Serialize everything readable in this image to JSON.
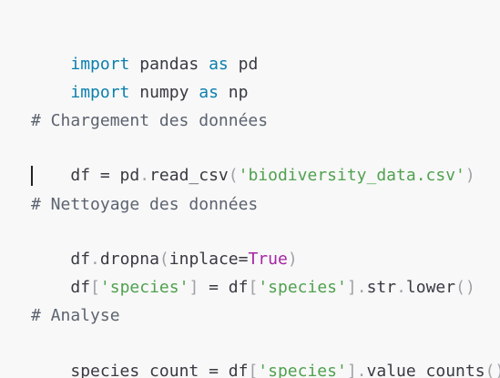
{
  "editor": {
    "lines": [
      {
        "kw1": "import",
        "rest": " pandas ",
        "kw2": "as",
        "alias": " pd"
      },
      {
        "kw1": "import",
        "rest": " numpy ",
        "kw2": "as",
        "alias": " np"
      },
      {
        "comment": "# Chargement des données"
      },
      {
        "a": "df ",
        "op": "=",
        "b": " pd",
        "dot": ".",
        "fn": "read_csv",
        "p1": "(",
        "str": "'biodiversity_data.csv'",
        "p2": ")"
      },
      {
        "comment": "# Nettoyage des données"
      },
      {
        "a": "df",
        "dot": ".",
        "fn": "dropna",
        "p1": "(",
        "arg": "inplace",
        "eq": "=",
        "bool": "True",
        "p2": ")"
      },
      {
        "a": "df",
        "b1": "[",
        "s1": "'species'",
        "b2": "]",
        "op": " = ",
        "c": "df",
        "b3": "[",
        "s2": "'species'",
        "b4": "]",
        "d1": ".",
        "m1": "str",
        "d2": ".",
        "m2": "lower",
        "p": "()"
      },
      {
        "comment": "# Analyse"
      },
      {
        "a": "species_count ",
        "op": "=",
        "c": " df",
        "b1": "[",
        "s1": "'species'",
        "b2": "]",
        "d1": ".",
        "m1": "value_counts",
        "p": "()"
      }
    ]
  }
}
